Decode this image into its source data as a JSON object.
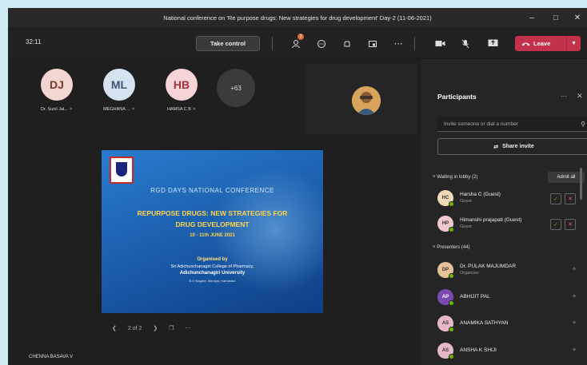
{
  "window": {
    "title": "National conference on 'Re purpose drugs: New strategies for drug development' Day-2 (11-06-2021)"
  },
  "toolbar": {
    "timer": "32:11",
    "take_control": "Take control",
    "leave": "Leave",
    "participants_badge": "3"
  },
  "gallery": {
    "people": [
      {
        "initials": "DJ",
        "name": "Dr. Sunil Jal...",
        "color": "#f3d6cf",
        "text": "#7a3a2c"
      },
      {
        "initials": "ML",
        "name": "MEGHANA ...",
        "color": "#d5e3f0",
        "text": "#3a5574"
      },
      {
        "initials": "HB",
        "name": "HAMSA C B",
        "color": "#f6d3d6",
        "text": "#a3303d"
      }
    ],
    "more": "+63"
  },
  "slide": {
    "header": "RGD DAYS NATIONAL CONFERENCE",
    "title_line1": "REPURPOSE DRUGS: NEW STRATEGIES FOR",
    "title_line2": "DRUG DEVELOPMENT",
    "dates": "10 - 11th JUNE 2021",
    "organised_by": "Organised by",
    "college": "Sri Adichunchanagiri College of Pharmacy,",
    "university": "Adichunchanagiri University",
    "address": "B.G Nagara, Mandya, Karnataka",
    "page": "2 of 2"
  },
  "presenter": "CHENNA BASAVA V",
  "participants": {
    "title": "Participants",
    "invite_placeholder": "Invite someone or dial a number",
    "share_invite": "Share invite",
    "lobby_header": "Waiting in lobby (2)",
    "admit_all": "Admit all",
    "lobby": [
      {
        "initials": "HC",
        "name": "Harsha C (Guest)",
        "role": "Guest",
        "color": "#f2d9b8"
      },
      {
        "initials": "HP",
        "name": "Himanshi prajapati (Guest)",
        "role": "Guest",
        "color": "#f2c9cf"
      }
    ],
    "presenters_header": "Presenters (44)",
    "presenters": [
      {
        "initials": "DP",
        "name": "Dr. PULAK MAJUMDAR",
        "role": "Organizer",
        "color": "#e8c39a"
      },
      {
        "initials": "AP",
        "name": "ABHIJIT PAL",
        "role": "",
        "color": "#7a4ab0"
      },
      {
        "initials": "AS",
        "name": "ANAMIKA SATHYAN",
        "role": "",
        "color": "#e9b8c8"
      },
      {
        "initials": "AS",
        "name": "ANSHA K SHIJI",
        "role": "",
        "color": "#e9b8c8"
      }
    ]
  }
}
